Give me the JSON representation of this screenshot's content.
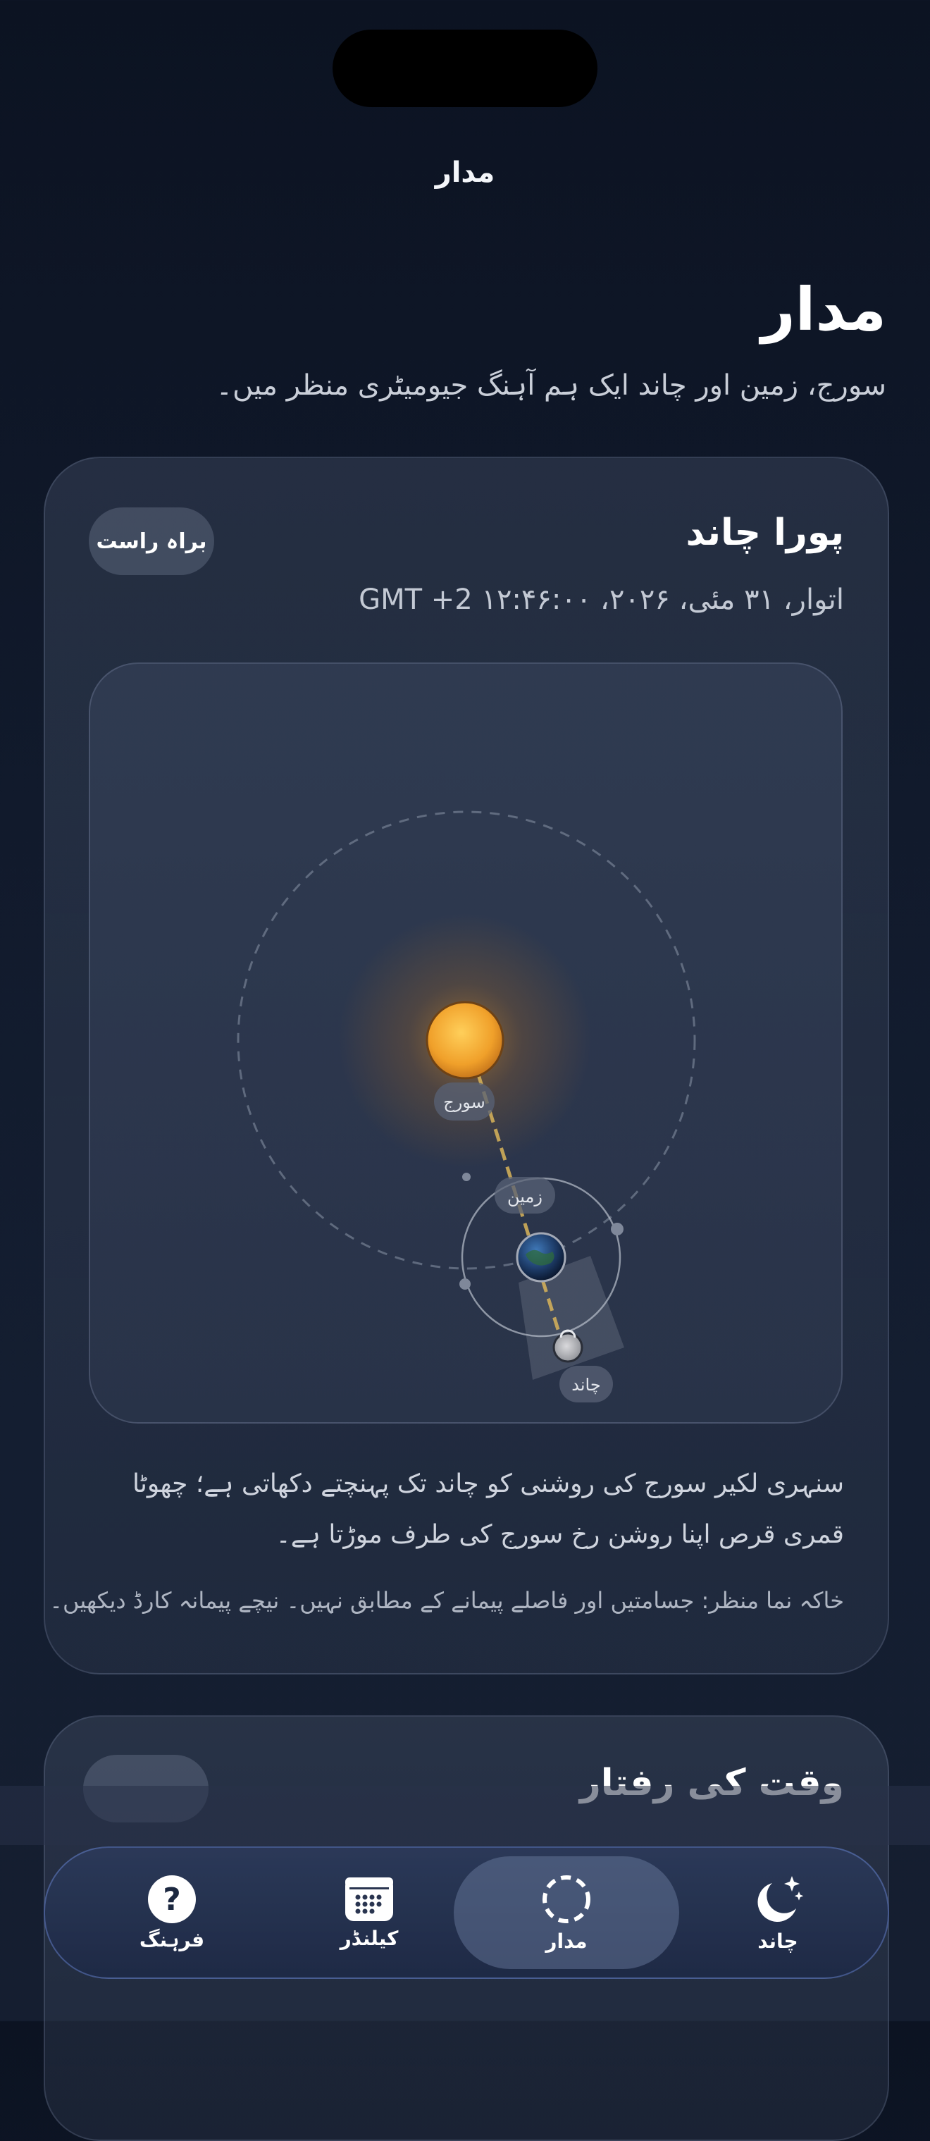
{
  "nav": {
    "title": "مدار"
  },
  "header": {
    "title": "مدار",
    "subtitle": "سورج، زمین اور چاند ایک ہم آہنگ جیومیٹری منظر میں۔"
  },
  "orbit_card": {
    "phase": "پورا چاند",
    "live_label": "براہ راست",
    "datetime": "اتوار، ۳۱ مئی، ۲۰۲۶، ۱۲:۴۶:۰۰ GMT +2",
    "labels": {
      "sun": "سورج",
      "earth": "زمین",
      "moon": "چاند"
    },
    "description": "سنہری لکیر سورج کی روشنی کو چاند تک پہنچتے دکھاتی ہے؛ چھوٹا قمری قرص اپنا روشن رخ سورج کی طرف موڑتا ہے۔",
    "note": "خاکہ نما منظر: جسامتیں اور فاصلے پیمانے کے مطابق نہیں۔ نیچے پیمانہ کارڈ دیکھیں۔"
  },
  "second_card": {
    "title": "وقت کی رفتار"
  },
  "tabbar": {
    "items": [
      {
        "label": "فرہنگ",
        "icon": "question-circle-icon"
      },
      {
        "label": "کیلنڈر",
        "icon": "calendar-icon"
      },
      {
        "label": "مدار",
        "icon": "orbit-circle-icon"
      },
      {
        "label": "چاند",
        "icon": "moon-stars-icon"
      }
    ],
    "active": "مدار"
  },
  "colors": {
    "sun": "#f3a32a",
    "accent": "#d9b45a",
    "background": "#111a2c"
  }
}
